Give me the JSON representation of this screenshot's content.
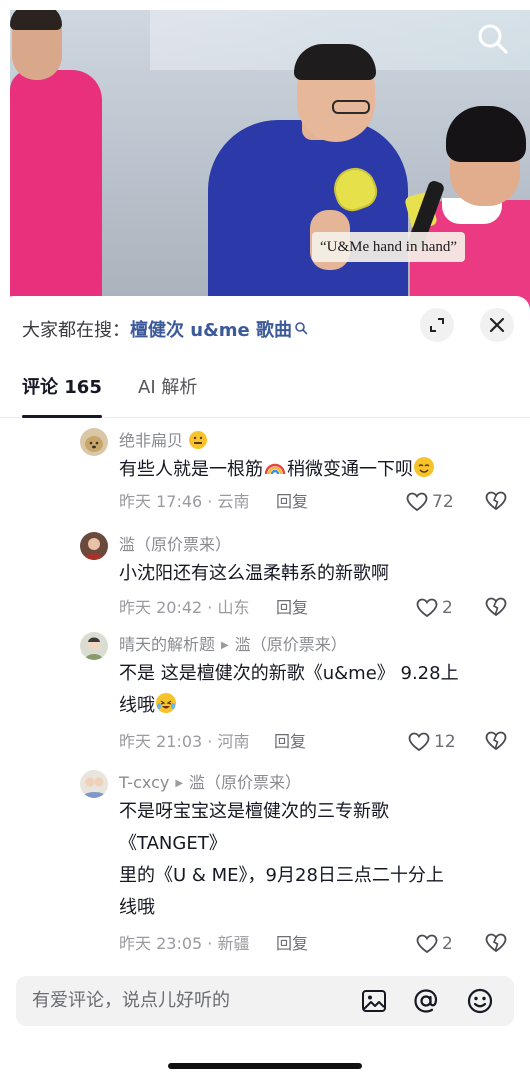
{
  "video": {
    "subtitle": "“U&Me hand in hand”",
    "icons": {
      "search": "search-icon"
    }
  },
  "sheet": {
    "suggest_prefix": "大家都在搜：",
    "suggest_query": "檀健次 u&me 歌曲",
    "icons": {
      "expand": "expand-icon",
      "close": "close-icon"
    }
  },
  "tabs": {
    "comments": "评论 165",
    "ai": "AI 解析"
  },
  "comments": [
    {
      "author": "绝非扁贝",
      "text": "有些人就是一根筋",
      "text_tail": "稍微变通一下呗",
      "time": "昨天 17:46 · 云南",
      "reply": "回复",
      "likes": "72"
    },
    {
      "author": "滥（原价票来）",
      "text": "小沈阳还有这么温柔韩系的新歌啊",
      "time": "昨天 20:42 · 山东",
      "reply": "回复",
      "likes": "2"
    },
    {
      "author": "晴天的解析题",
      "reply_to": "滥（原价票来）",
      "text_line1": "不是 这是檀健次的新歌《u&me》 9.28上",
      "text_line2": "线哦",
      "time": "昨天 21:03 · 河南",
      "reply": "回复",
      "likes": "12"
    },
    {
      "author": "T-cxcy",
      "reply_to": "滥（原价票来）",
      "text_line1": "不是呀宝宝这是檀健次的三专新歌",
      "text_line2": "《TANGET》",
      "text_line3": "里的《U & ME》，9月28日三点二十分上",
      "text_line4": "线哦",
      "time": "昨天 23:05 · 新疆",
      "reply": "回复",
      "likes": "2"
    }
  ],
  "input": {
    "placeholder": "有爱评论，说点儿好听的",
    "icons": {
      "image": "image-icon",
      "mention": "at-icon",
      "emoji": "emoji-icon"
    }
  },
  "colors": {
    "query_link": "#3c5a9a",
    "sheet_bg": "#ffffff",
    "input_bg": "#f2f2f3"
  }
}
